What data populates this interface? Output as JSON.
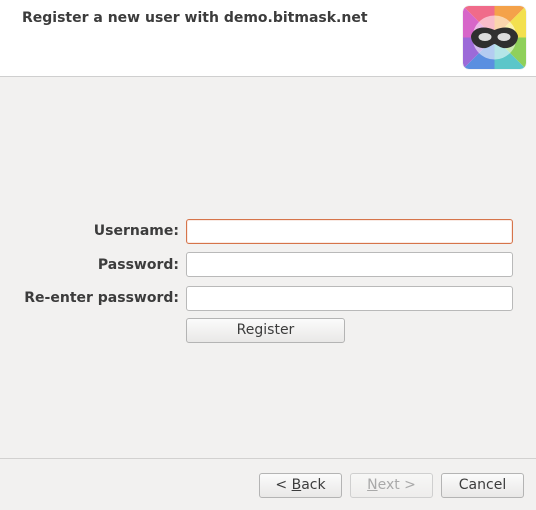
{
  "header": {
    "title": "Register a new user with demo.bitmask.net",
    "logo_icon": "bitmask-mask-icon"
  },
  "form": {
    "username_label": "Username:",
    "username_value": "",
    "password_label": "Password:",
    "password_value": "",
    "reenter_label": "Re-enter password:",
    "reenter_value": "",
    "register_label": "Register"
  },
  "footer": {
    "back": {
      "prefix": "< ",
      "mnemonic": "B",
      "rest": "ack",
      "enabled": true
    },
    "next": {
      "mnemonic": "N",
      "rest": "ext >",
      "enabled": false
    },
    "cancel_label": "Cancel"
  },
  "colors": {
    "focus_border": "#d6744a",
    "background": "#f2f1f0",
    "header_bg": "#ffffff"
  }
}
